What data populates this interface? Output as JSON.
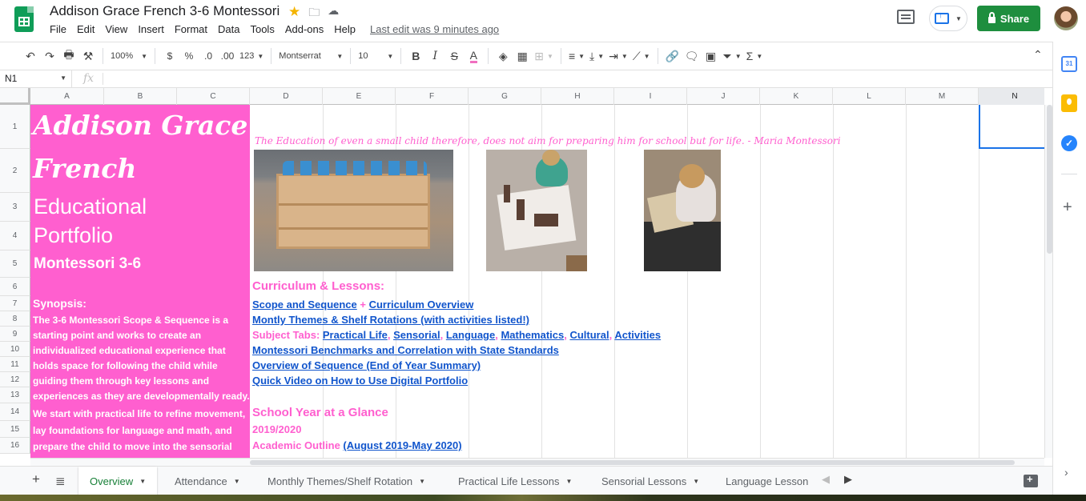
{
  "doc": {
    "title": "Addison Grace French 3-6 Montessori",
    "last_edit": "Last edit was 9 minutes ago"
  },
  "menu": [
    "File",
    "Edit",
    "View",
    "Insert",
    "Format",
    "Data",
    "Tools",
    "Add-ons",
    "Help"
  ],
  "header": {
    "share_label": "Share"
  },
  "toolbar": {
    "zoom": "100%",
    "currency": "$",
    "percent": "%",
    "dec_less": ".0",
    "dec_more": ".00",
    "number_format": "123",
    "font": "Montserrat",
    "font_size": "10"
  },
  "formula_bar": {
    "cell_ref": "N1",
    "fx": "fx"
  },
  "columns": [
    "A",
    "B",
    "C",
    "D",
    "E",
    "F",
    "G",
    "H",
    "I",
    "J",
    "K",
    "L",
    "M",
    "N"
  ],
  "rows": [
    "1",
    "2",
    "3",
    "4",
    "5",
    "6",
    "7",
    "8",
    "9",
    "10",
    "11",
    "12",
    "13",
    "14",
    "15",
    "16"
  ],
  "sheet": {
    "name_line1": "Addison Grace",
    "name_line2": "French",
    "edu_line1": "Educational",
    "edu_line2": "Portfolio",
    "program": "Montessori 3-6",
    "synopsis_title": "Synopsis:",
    "synopsis_lines": [
      "The 3-6 Montessori Scope & Sequence is a",
      "starting point and works to create an",
      "individualized educational experience that",
      "holds space for following the child while",
      "guiding them through key lessons and",
      "experiences as they are developmentally ready.",
      "We start with practical life to refine movement,",
      "lay foundations for language and math, and",
      "prepare the child to move into the sensorial"
    ],
    "quote": "The Education of even a small child therefore, does not aim for preparing him for school but for life. - Maria Montessori",
    "curriculum_title": "Curriculum & Lessons:",
    "scope_link": "Scope and Sequence",
    "plus": " + ",
    "overview_link": "Curriculum Overview",
    "themes_link": "Montly Themes & Shelf Rotations (with activities listed!) ",
    "subject_tabs_label": "Subject Tabs: ",
    "subject_tabs": [
      "Practical Life",
      "Sensorial",
      "Language",
      "Mathematics",
      "Cultural",
      "Activities"
    ],
    "comma": ", ",
    "benchmarks_link": "Montessori Benchmarks and Correlation with State Standards ",
    "sequence_link": "Overview of Sequence (End of Year Summary)",
    "video_link": "Quick Video on How to Use Digital Portfolio",
    "year_title": "School Year at a Glance",
    "year_range": "2019/2020",
    "academic_label": "Academic Outline ",
    "academic_link": "(August 2019-May 2020)"
  },
  "tabs": [
    "Overview",
    "Attendance",
    "Monthly Themes/Shelf Rotation",
    "Practical Life Lessons",
    "Sensorial Lessons",
    "Language Lesson"
  ],
  "colors": {
    "accent_pink": "#ff5fcf",
    "link_blue": "#1155cc",
    "share_green": "#1e8e3e",
    "active_tab_green": "#188038"
  }
}
